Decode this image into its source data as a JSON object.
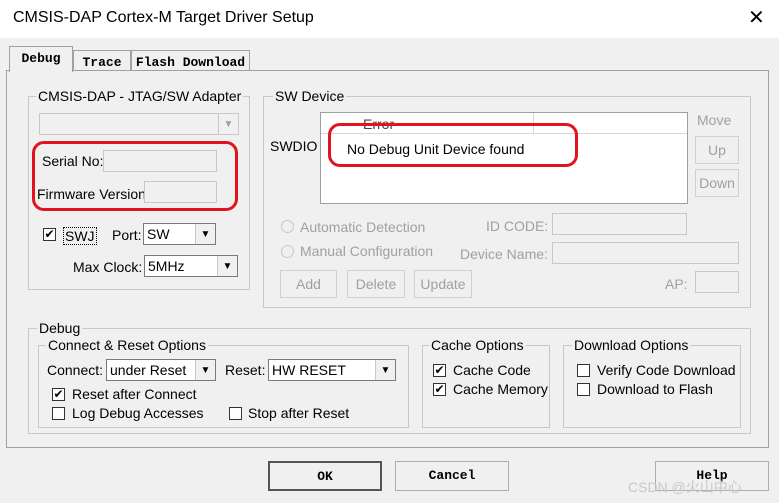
{
  "window": {
    "title": "CMSIS-DAP Cortex-M Target Driver Setup",
    "close_glyph": "✕"
  },
  "tabs": [
    {
      "label": "Debug",
      "active": true
    },
    {
      "label": "Trace",
      "active": false
    },
    {
      "label": "Flash Download",
      "active": false
    }
  ],
  "adapter": {
    "legend": "CMSIS-DAP - JTAG/SW Adapter",
    "serial_label": "Serial No:",
    "serial_value": "",
    "firmware_label": "Firmware Version:",
    "firmware_value": "",
    "swj_label": "SWJ",
    "swj_checked": "✔",
    "port_label": "Port:",
    "port_value": "SW",
    "clock_label": "Max Clock:",
    "clock_value": "5MHz"
  },
  "sw_device": {
    "legend": "SW Device",
    "swdio_label": "SWDIO",
    "column_header": "Error",
    "message": "No Debug Unit Device found",
    "move_label": "Move",
    "up_label": "Up",
    "down_label": "Down",
    "auto_detect_label": "Automatic Detection",
    "manual_config_label": "Manual Configuration",
    "id_code_label": "ID CODE:",
    "device_name_label": "Device Name:",
    "add_label": "Add",
    "delete_label": "Delete",
    "update_label": "Update",
    "ap_label": "AP:"
  },
  "debug_group": {
    "legend": "Debug",
    "connect_reset": {
      "legend": "Connect & Reset Options",
      "connect_label": "Connect:",
      "connect_value": "under Reset",
      "reset_label": "Reset:",
      "reset_value": "HW RESET",
      "reset_after_connect_label": "Reset after Connect",
      "reset_after_connect_checked": "✔",
      "log_debug_label": "Log Debug Accesses",
      "stop_after_reset_label": "Stop after Reset"
    },
    "cache": {
      "legend": "Cache Options",
      "cache_code_label": "Cache Code",
      "cache_code_checked": "✔",
      "cache_memory_label": "Cache Memory",
      "cache_memory_checked": "✔"
    },
    "download": {
      "legend": "Download Options",
      "verify_label": "Verify Code Download",
      "flash_label": "Download to Flash"
    }
  },
  "footer": {
    "ok_label": "OK",
    "cancel_label": "Cancel",
    "help_label": "Help"
  },
  "watermark": "CSDN @火山中心",
  "colors": {
    "annotation_red": "#e0141e",
    "dialog_bg": "#f0f0f0"
  }
}
